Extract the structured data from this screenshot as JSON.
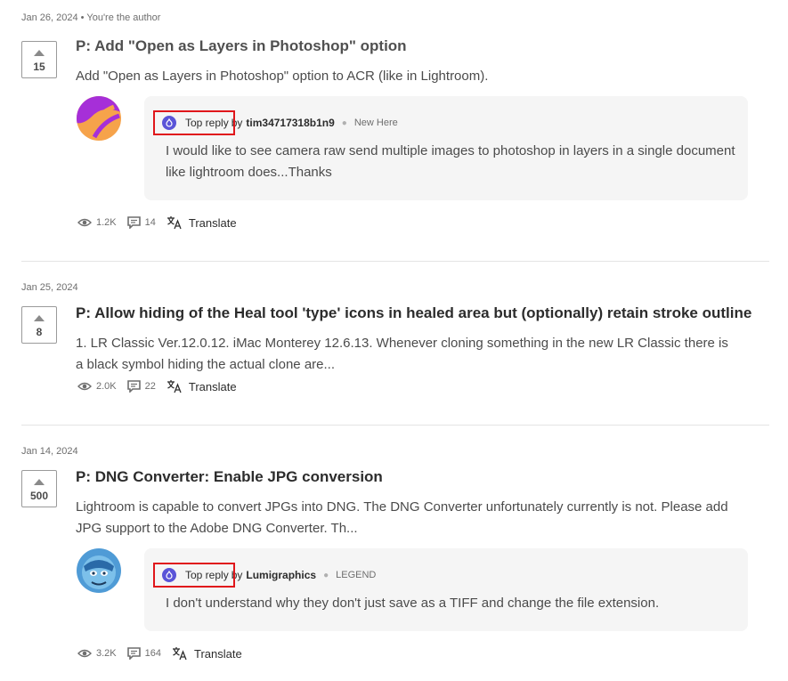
{
  "posts": [
    {
      "date": "Jan 26, 2024",
      "author_note": "You're the author",
      "votes": "15",
      "title": "P: Add \"Open as Layers in Photoshop\" option",
      "body": "Add \"Open as Layers in Photoshop\" option to ACR (like in Lightroom).",
      "reply": {
        "label": "Top reply",
        "by": "by",
        "user": "tim34717318b1n9",
        "rank": "New Here",
        "text": "I would like to see camera raw send multiple images to photoshop in layers in a single document like lightroom does...Thanks"
      },
      "views": "1.2K",
      "comments": "14",
      "translate": "Translate"
    },
    {
      "date": "Jan 25, 2024",
      "votes": "8",
      "title": "P: Allow hiding of the Heal tool 'type' icons in healed area but (optionally) retain stroke outline",
      "body": "1. LR Classic Ver.12.0.12. iMac Monterey 12.6.13. Whenever cloning something in the new LR Classic there is a black symbol hiding the actual clone are...",
      "views": "2.0K",
      "comments": "22",
      "translate": "Translate"
    },
    {
      "date": "Jan 14, 2024",
      "votes": "500",
      "title": "P: DNG Converter: Enable JPG conversion",
      "body": "Lightroom is capable to convert JPGs into DNG. The DNG Converter unfortunately currently is not. Please add JPG support to the Adobe DNG Converter. Th...",
      "reply": {
        "label": "Top reply",
        "by": "by",
        "user": "Lumigraphics",
        "rank": "LEGEND",
        "text": "I don't understand why they don't just save as a TIFF and change the file extension."
      },
      "views": "3.2K",
      "comments": "164",
      "translate": "Translate"
    }
  ],
  "colors": {
    "highlight_box": "#e0161b",
    "badge": "#5a54d8",
    "reply_card": "#f5f5f5"
  }
}
